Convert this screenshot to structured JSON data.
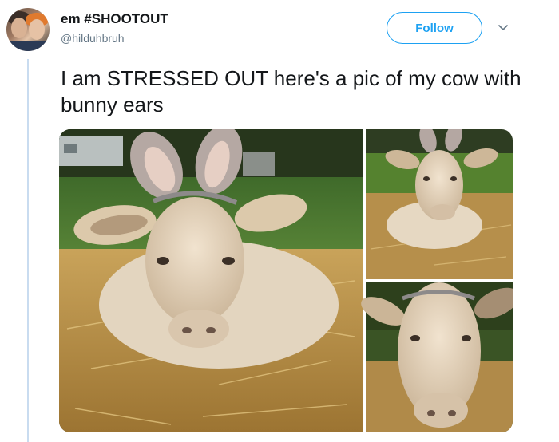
{
  "user": {
    "display_name": "em #SHOOTOUT",
    "handle": "@hilduhbruh"
  },
  "actions": {
    "follow_label": "Follow"
  },
  "tweet": {
    "text": "I am STRESSED OUT here's a pic of my cow with bunny ears"
  },
  "colors": {
    "accent": "#1da1f2",
    "text": "#14171a",
    "secondary_text": "#657786"
  },
  "icons": {
    "menu": "chevron-down-icon"
  }
}
